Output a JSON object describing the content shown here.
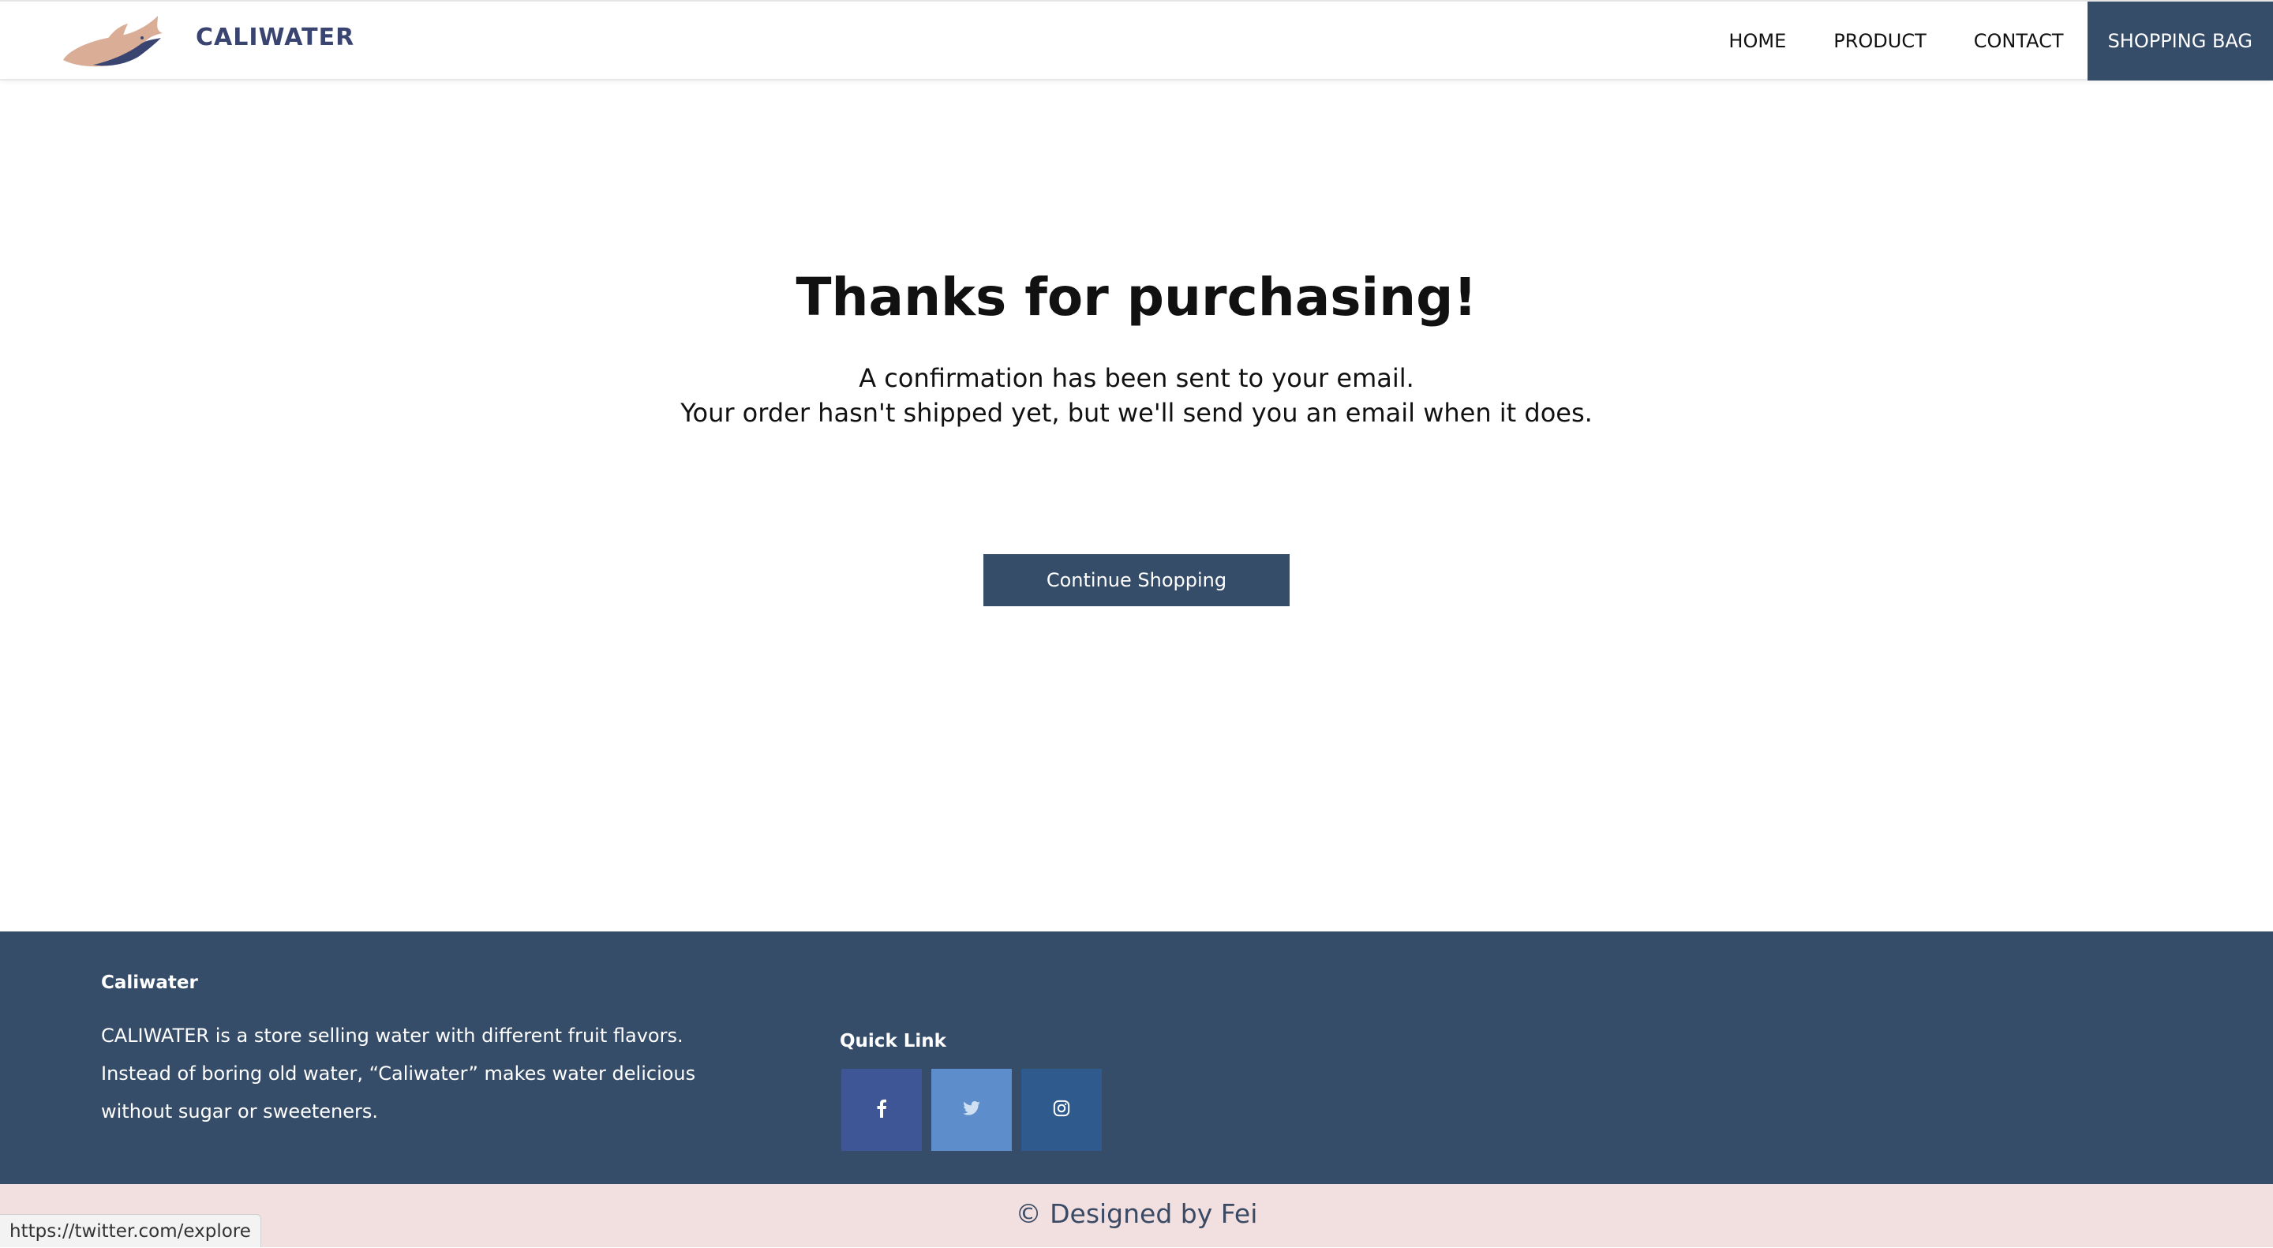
{
  "header": {
    "brand": "CALIWATER",
    "nav": [
      {
        "label": "HOME"
      },
      {
        "label": "PRODUCT"
      },
      {
        "label": "CONTACT"
      },
      {
        "label": "SHOPPING BAG"
      }
    ]
  },
  "main": {
    "title": "Thanks for purchasing!",
    "line1": "A confirmation has been sent to your email.",
    "line2": "Your order hasn't shipped yet, but we'll send you an email when it does.",
    "button": "Continue Shopping"
  },
  "footer": {
    "title": "Caliwater",
    "description": "CALIWATER is a store selling water with different fruit flavors. Instead of boring old water, “Caliwater” makes water delicious without sugar or sweeteners.",
    "quick_link_title": "Quick Link",
    "social": [
      {
        "icon": "facebook-icon",
        "color": "#3e5596"
      },
      {
        "icon": "twitter-icon",
        "color": "#5d8ecb"
      },
      {
        "icon": "instagram-icon",
        "color": "#2f5a8e"
      }
    ]
  },
  "bottom": {
    "copyright": "© Designed by Fei"
  },
  "status_bar": {
    "url": "https://twitter.com/explore"
  },
  "colors": {
    "accent": "#364d69",
    "brand_text": "#3a4470",
    "bottom_bg": "#f2e0e0"
  }
}
